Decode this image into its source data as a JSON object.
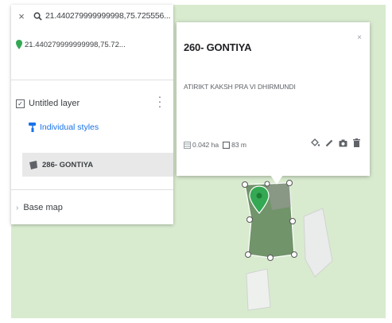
{
  "search": {
    "close_label": "×",
    "query": "21.440279999999998,75.725556...",
    "icon": "search-icon"
  },
  "result": {
    "text": "21.440279999999998,75.72...",
    "icon": "map-pin-icon"
  },
  "layer": {
    "checkbox_mark": "✓",
    "name": "Untitled layer",
    "styles_link": "Individual styles",
    "feature_name": "286- GONTIYA"
  },
  "basemap": {
    "label": "Base map"
  },
  "popup": {
    "title": "260- GONTIYA",
    "close_label": "×",
    "description": "ATIRIKT KAKSH PRA VI DHIRMUNDI",
    "area": "0.042 ha",
    "perimeter": "83 m",
    "actions": [
      "paint-bucket-icon",
      "pencil-icon",
      "camera-icon",
      "trash-icon"
    ]
  },
  "colors": {
    "map_background": "#d8ebcf",
    "polygon_fill": "#6b8f64",
    "marker_green": "#34a853",
    "link_blue": "#1a73e8"
  }
}
